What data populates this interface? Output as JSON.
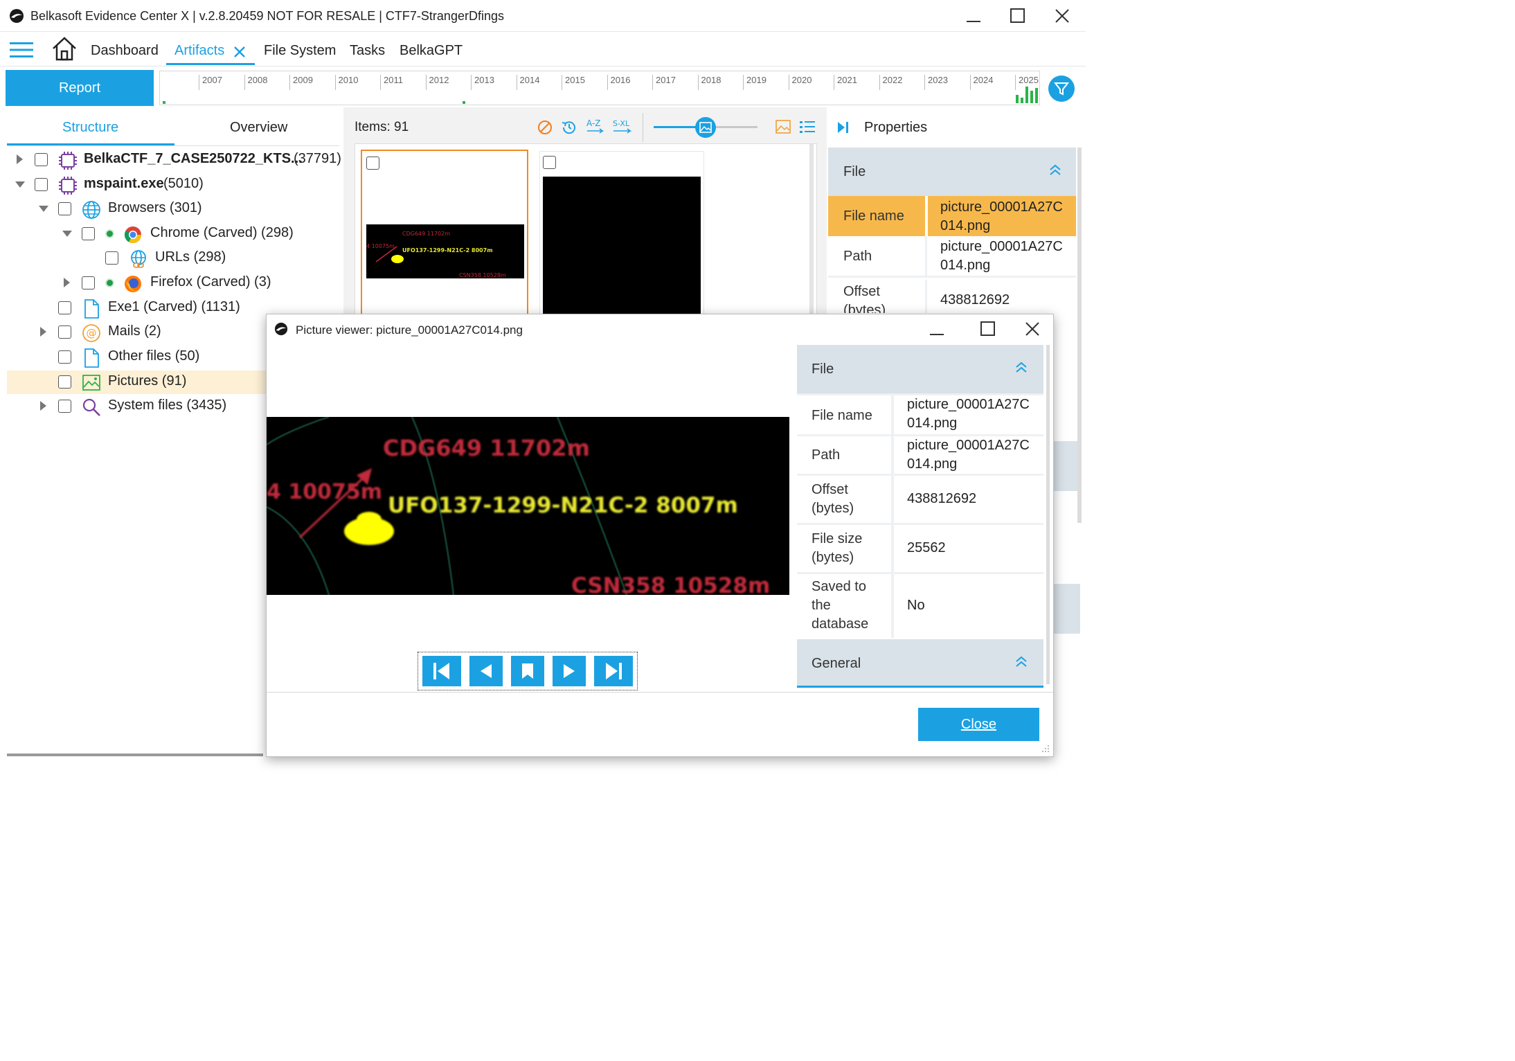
{
  "app": {
    "title": "Belkasoft Evidence Center X | v.2.8.20459 NOT FOR RESALE | CTF7-StrangerDfings"
  },
  "nav": {
    "dashboard": "Dashboard",
    "artifacts": "Artifacts",
    "file_system": "File System",
    "tasks": "Tasks",
    "belkagpt": "BelkaGPT"
  },
  "toolbar": {
    "report_label": "Report"
  },
  "timeline": {
    "years": [
      "2007",
      "2008",
      "2009",
      "2010",
      "2011",
      "2012",
      "2013",
      "2014",
      "2015",
      "2016",
      "2017",
      "2018",
      "2019",
      "2020",
      "2021",
      "2022",
      "2023",
      "2024",
      "2025"
    ]
  },
  "left_panel": {
    "tabs": [
      "Structure",
      "Overview"
    ],
    "tree": [
      {
        "label": "BelkaCTF_7_CASE250722_KTS...",
        "count": "(37791)",
        "bold": true
      },
      {
        "label": "mspaint.exe",
        "count": "(5010)",
        "bold": true
      },
      {
        "label": "Browsers (301)"
      },
      {
        "label": "Chrome (Carved) (298)"
      },
      {
        "label": "URLs (298)"
      },
      {
        "label": "Firefox (Carved) (3)"
      },
      {
        "label": "Exe1 (Carved) (1131)"
      },
      {
        "label": "Mails (2)"
      },
      {
        "label": "Other files (50)"
      },
      {
        "label": "Pictures (91)"
      },
      {
        "label": "System files (3435)"
      }
    ]
  },
  "middle": {
    "items_label": "Items: 91"
  },
  "properties": {
    "title": "Properties",
    "section_file": "File",
    "rows": [
      {
        "key": "File name",
        "value": "picture_00001A27C014.png"
      },
      {
        "key": "Path",
        "value": "picture_00001A27C014.png"
      },
      {
        "key": "Offset (bytes)",
        "value": "438812692"
      }
    ]
  },
  "viewer": {
    "title": "Picture viewer: picture_00001A27C014.png",
    "section_file": "File",
    "section_general": "General",
    "rows": [
      {
        "key": "File name",
        "value": "picture_00001A27C014.png"
      },
      {
        "key": "Path",
        "value": "picture_00001A27C014.png"
      },
      {
        "key": "Offset (bytes)",
        "value": "438812692"
      },
      {
        "key": "File size (bytes)",
        "value": "25562"
      },
      {
        "key": "Saved to the database",
        "value": "No"
      }
    ],
    "image_labels": {
      "top": "CDG649 11702m",
      "left": "4 10075m",
      "main": "UFO137-1299-N21C-2 8007m",
      "bottom": "CSN358 10528m"
    },
    "close_label": "Close"
  },
  "colors": {
    "accent": "#1ba1e2",
    "selected_row": "#f7b84b",
    "tree_selected": "#fdf0d5",
    "section_bg": "#d9e2e8"
  }
}
